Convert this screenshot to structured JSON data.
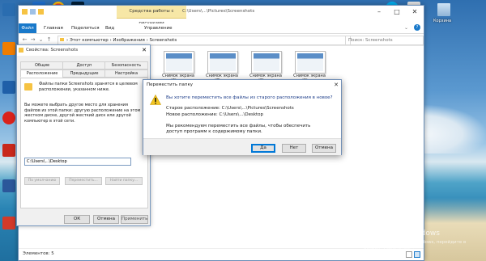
{
  "explorer": {
    "ribbon_context_tab": "Средства работы с рисунками",
    "title_path": "C:\\Users\\...\\Pictures\\Screenshots",
    "tabs": [
      "Файл",
      "Главная",
      "Поделиться",
      "Вид",
      "Управление"
    ],
    "address": "› Этот компьютер › Изображения › Screenshots",
    "search_placeholder": "Поиск: Screenshots",
    "thumbnails": [
      "Снимок экрана (6).png",
      "Снимок экрана (7).png",
      "Снимок экрана (8).png",
      "Снимок экрана (9).png"
    ],
    "status": "Элементов: 5"
  },
  "properties": {
    "title": "Свойства: Screenshots",
    "tabs_row1": [
      "Общие",
      "Доступ",
      "Безопасность"
    ],
    "tabs_row2": [
      "Расположение",
      "Предыдущие версии",
      "Настройка"
    ],
    "info_text": "Файлы папки Screenshots хранятся в целевом расположении, указанном ниже.",
    "desc_text": "Вы можете выбрать другое место для хранения файлов из этой папки: другую расположение на этом жестком диске, другой жесткий диск или другой компьютер в этой сети.",
    "path": "C:\\Users\\...\\Desktop",
    "btn_restore": "По умолчанию",
    "btn_move": "Переместить...",
    "btn_find": "Найти папку...",
    "ok": "ОК",
    "cancel": "Отмена",
    "apply": "Применить"
  },
  "move_dialog": {
    "title": "Переместить папку",
    "question": "Вы хотите переместить все файлы из старого расположения в новое?",
    "old_location": "Старое расположение: C:\\Users\\...\\Pictures\\Screenshots",
    "new_location": "Новое расположение: C:\\Users\\...\\Desktop",
    "recommendation": "Мы рекомендуем переместить все файлы, чтобы обеспечить доступ программ к содержимому папки.",
    "yes": "Да",
    "no": "Нет",
    "cancel": "Отмена"
  },
  "desktop": {
    "recycle_bin_label": "Корзина",
    "watermark_title": "Активация Windows",
    "watermark_text": "Чтобы активировать Windows, перейдите в раздел \"Параметры\"."
  },
  "colors": {
    "accent": "#1979ca",
    "context_tab": "#f7e7a6",
    "warning": "#f3c623"
  }
}
